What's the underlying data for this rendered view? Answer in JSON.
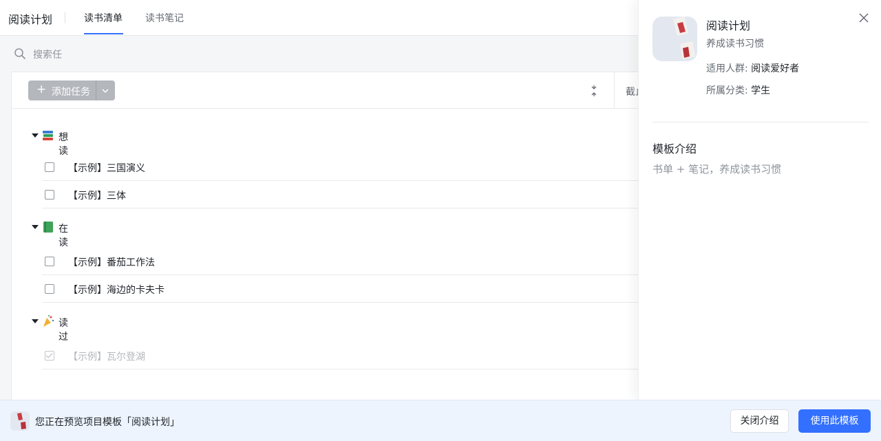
{
  "header": {
    "app_title": "阅读计划",
    "tabs": [
      {
        "label": "读书清单",
        "active": true
      },
      {
        "label": "读书笔记",
        "active": false
      }
    ]
  },
  "search": {
    "placeholder": "搜索任"
  },
  "toolbar": {
    "add_task_label": "添加任务",
    "column_header": "截止"
  },
  "groups": [
    {
      "name": "想读",
      "icon": "books-icon",
      "tasks": [
        {
          "name": "【示例】三国演义",
          "done": false
        },
        {
          "name": "【示例】三体",
          "done": false
        }
      ]
    },
    {
      "name": "在读",
      "icon": "green-book-icon",
      "tasks": [
        {
          "name": "【示例】番茄工作法",
          "done": false
        },
        {
          "name": "【示例】海边的卡夫卡",
          "done": false
        }
      ]
    },
    {
      "name": "读过",
      "icon": "party-popper-icon",
      "tasks": [
        {
          "name": "【示例】瓦尔登湖",
          "done": true
        }
      ]
    }
  ],
  "template": {
    "name": "阅读计划",
    "subtitle": "养成读书习惯",
    "audience_label": "适用人群:",
    "audience_value": "阅读爱好者",
    "category_label": "所属分类:",
    "category_value": "学生",
    "intro_title": "模板介绍",
    "intro_body": "书单 + 笔记，养成读书习惯"
  },
  "banner": {
    "text": "您正在预览项目模板「阅读计划」",
    "close_intro_label": "关闭介绍",
    "use_template_label": "使用此模板"
  },
  "colors": {
    "accent": "#3370ff",
    "banner_bg": "#eef4fd",
    "add_button_bg": "#b4b7bc"
  }
}
